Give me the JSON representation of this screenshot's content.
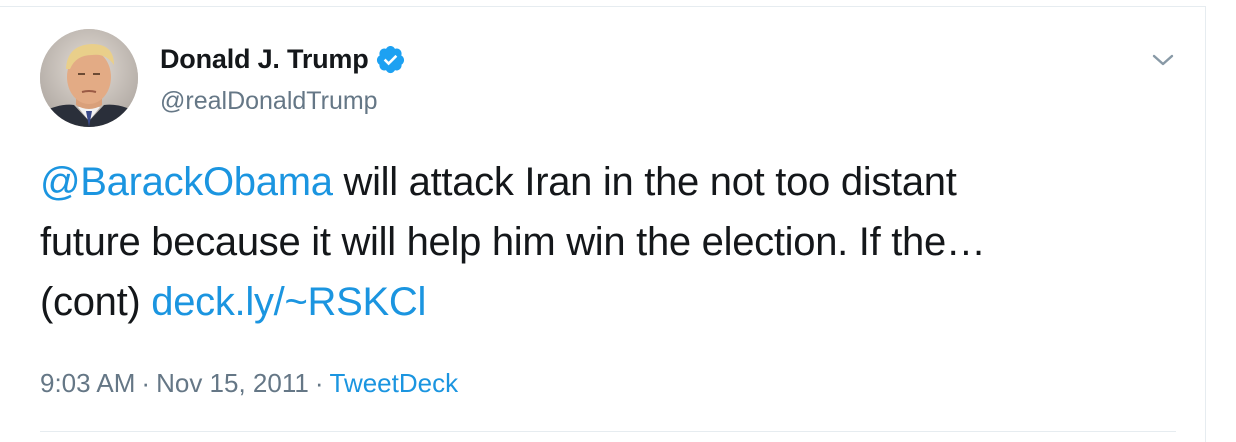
{
  "user": {
    "display_name": "Donald J. Trump",
    "handle": "@realDonaldTrump",
    "verified_icon": "verified-badge-icon",
    "avatar": "profile-photo"
  },
  "tweet": {
    "mention": "@BarackObama",
    "text_line1_rest": " will attack Iran in the not too distant",
    "text_line2": "future because it will help him win the election. If the…",
    "text_line3_prefix": "(cont) ",
    "link": "deck.ly/~RSKCl"
  },
  "meta": {
    "time": "9:03 AM",
    "separator": "·",
    "date": "Nov 15, 2011",
    "source": "TweetDeck"
  },
  "icons": {
    "more": "chevron-down-icon"
  },
  "colors": {
    "link": "#1b95e0",
    "text": "#14171a",
    "secondary": "#657786",
    "verified": "#1da1f2"
  }
}
